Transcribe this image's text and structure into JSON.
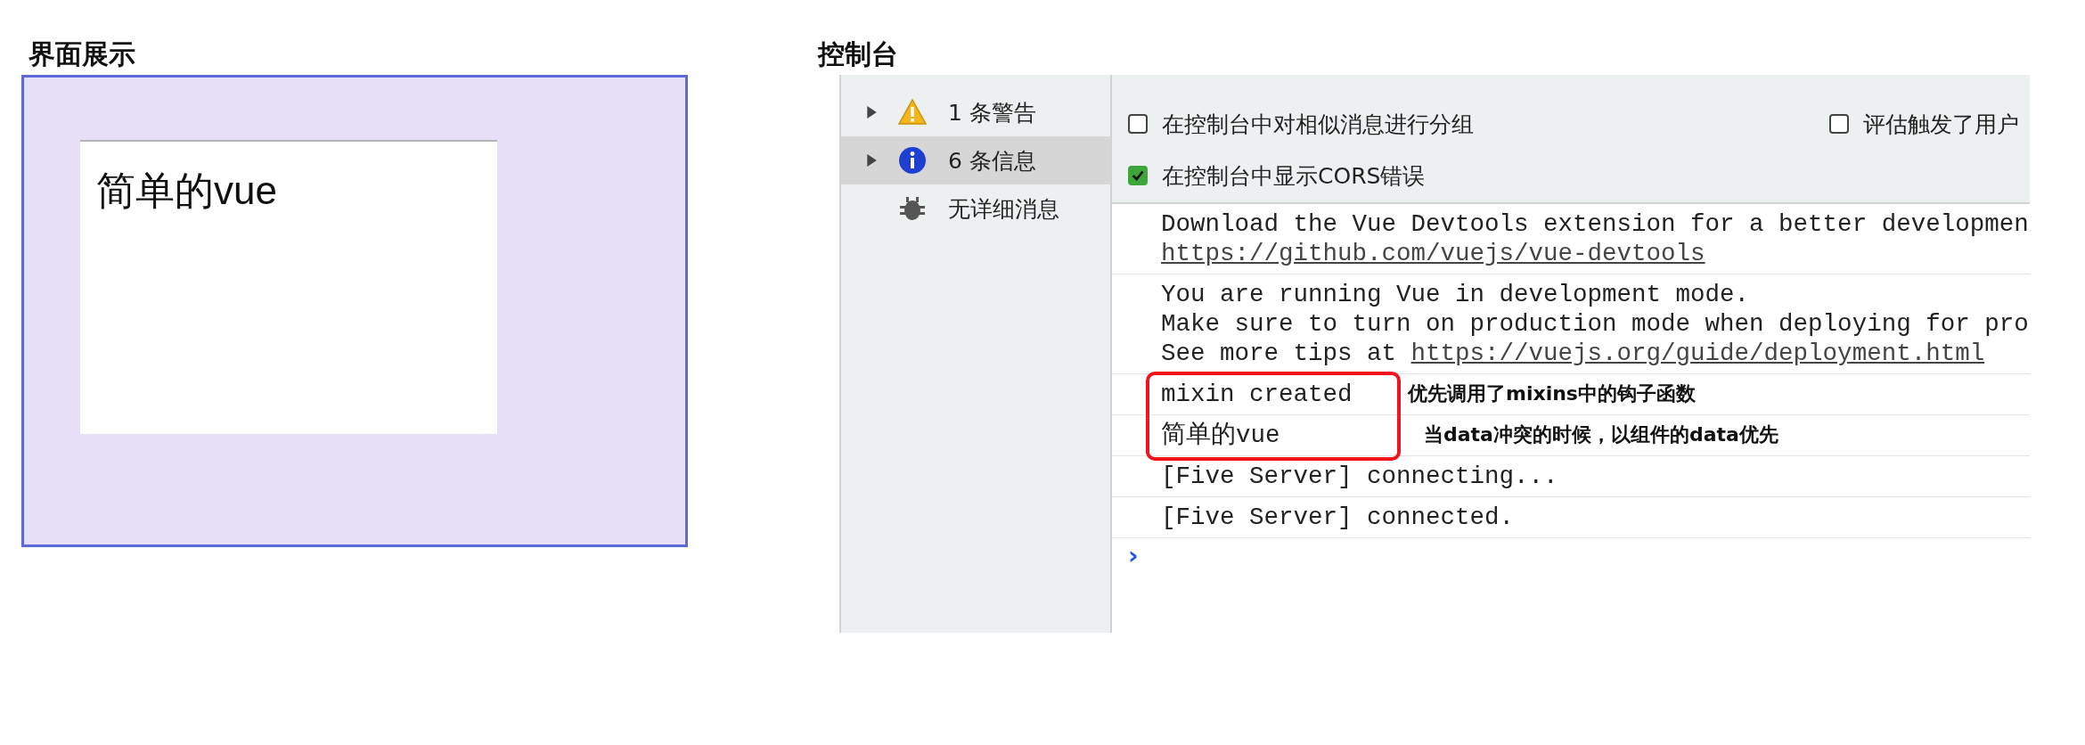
{
  "preview_panel": {
    "title": "界面展示",
    "page_text": "简单的vue"
  },
  "console_panel": {
    "title": "控制台",
    "sidebar": [
      {
        "kind": "warning",
        "label": "1 条警告",
        "selected": false,
        "expandable": true
      },
      {
        "kind": "info",
        "label": "6 条信息",
        "selected": true,
        "expandable": true
      },
      {
        "kind": "verbose",
        "label": "无详细消息",
        "selected": false,
        "expandable": false
      }
    ],
    "settings": [
      {
        "left": {
          "label": "在控制台中对相似消息进行分组",
          "checked": false
        },
        "right": {
          "label": "评估触发了用户",
          "checked": false
        }
      },
      {
        "left": {
          "label": "在控制台中显示CORS错误",
          "checked": true
        }
      }
    ],
    "log": [
      {
        "lines": [
          {
            "text": "Download the Vue Devtools extension for a better developmen"
          },
          {
            "link": "https://github.com/vuejs/vue-devtools"
          }
        ],
        "highlighted": false
      },
      {
        "lines": [
          {
            "text": "You are running Vue in development mode."
          },
          {
            "text": "Make sure to turn on production mode when deploying for pro"
          },
          {
            "text": "See more tips at ",
            "link": "https://vuejs.org/guide/deployment.html"
          }
        ],
        "highlighted": false
      },
      {
        "lines": [
          {
            "text": "mixin created"
          }
        ],
        "note": "优先调用了mixins中的钩子函数",
        "highlighted": true
      },
      {
        "lines": [
          {
            "text": "简单的vue"
          }
        ],
        "note": "当data冲突的时候，以组件的data优先",
        "highlighted": true
      },
      {
        "lines": [
          {
            "text": "[Five Server] connecting..."
          }
        ],
        "highlighted": false
      },
      {
        "lines": [
          {
            "text": "[Five Server] connected."
          }
        ],
        "highlighted": false
      }
    ],
    "prompt": "›"
  }
}
